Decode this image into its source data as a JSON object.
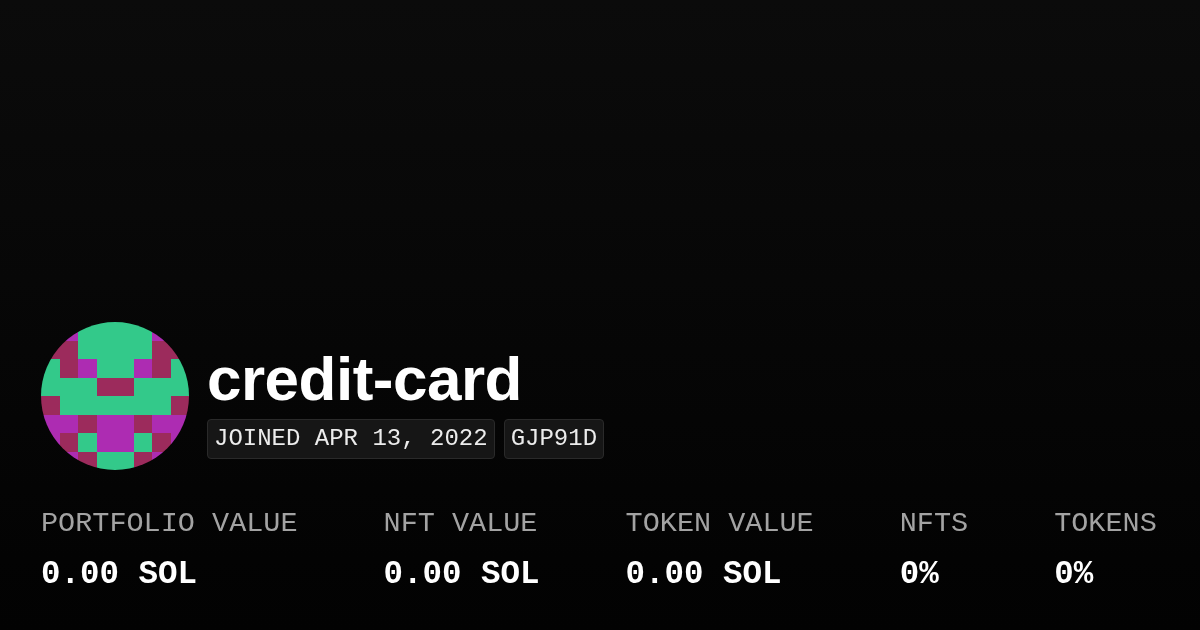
{
  "profile": {
    "name": "credit-card",
    "badges": [
      "JOINED APR 13, 2022",
      "GJP91D"
    ]
  },
  "stats": [
    {
      "label": "PORTFOLIO VALUE",
      "value": "0.00 SOL"
    },
    {
      "label": "NFT VALUE",
      "value": "0.00 SOL"
    },
    {
      "label": "TOKEN VALUE",
      "value": "0.00 SOL"
    },
    {
      "label": "NFTS",
      "value": "0%"
    },
    {
      "label": "TOKENS",
      "value": "0%"
    }
  ]
}
